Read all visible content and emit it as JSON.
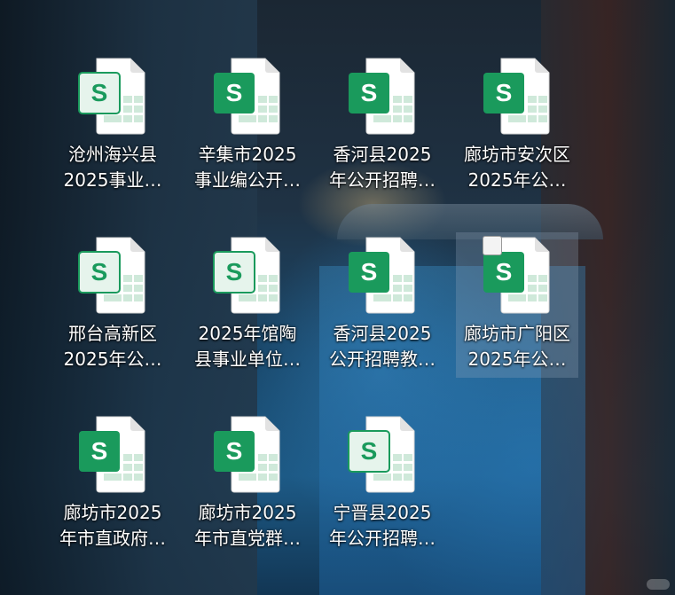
{
  "desktop": {
    "icons": [
      {
        "line1": "沧州海兴县",
        "line2": "2025事业…",
        "type": "excel-spreadsheet",
        "style": "light"
      },
      {
        "line1": "辛集市2025",
        "line2": "事业编公开…",
        "type": "excel-spreadsheet",
        "style": "dark"
      },
      {
        "line1": "香河县2025",
        "line2": "年公开招聘…",
        "type": "excel-spreadsheet",
        "style": "dark"
      },
      {
        "line1": "廊坊市安次区",
        "line2": "2025年公…",
        "type": "excel-spreadsheet",
        "style": "dark"
      },
      {
        "line1": "邢台高新区",
        "line2": "2025年公…",
        "type": "excel-spreadsheet",
        "style": "light"
      },
      {
        "line1": "2025年馆陶",
        "line2": "县事业单位…",
        "type": "excel-spreadsheet",
        "style": "light"
      },
      {
        "line1": "香河县2025",
        "line2": "公开招聘教…",
        "type": "excel-spreadsheet",
        "style": "dark"
      },
      {
        "line1": "廊坊市广阳区",
        "line2": "2025年公…",
        "type": "excel-spreadsheet",
        "style": "dark",
        "selected": true
      },
      {
        "line1": "廊坊市2025",
        "line2": "年市直政府…",
        "type": "excel-spreadsheet",
        "style": "dark"
      },
      {
        "line1": "廊坊市2025",
        "line2": "年市直党群…",
        "type": "excel-spreadsheet",
        "style": "dark"
      },
      {
        "line1": "宁晋县2025",
        "line2": "年公开招聘…",
        "type": "excel-spreadsheet",
        "style": "light"
      }
    ],
    "icon_letter": "S",
    "colors": {
      "accent_dark": "#1a9a5c",
      "accent_light_bg": "#e6f4ec",
      "paper": "#ffffff",
      "grid": "#cfe9da"
    }
  }
}
